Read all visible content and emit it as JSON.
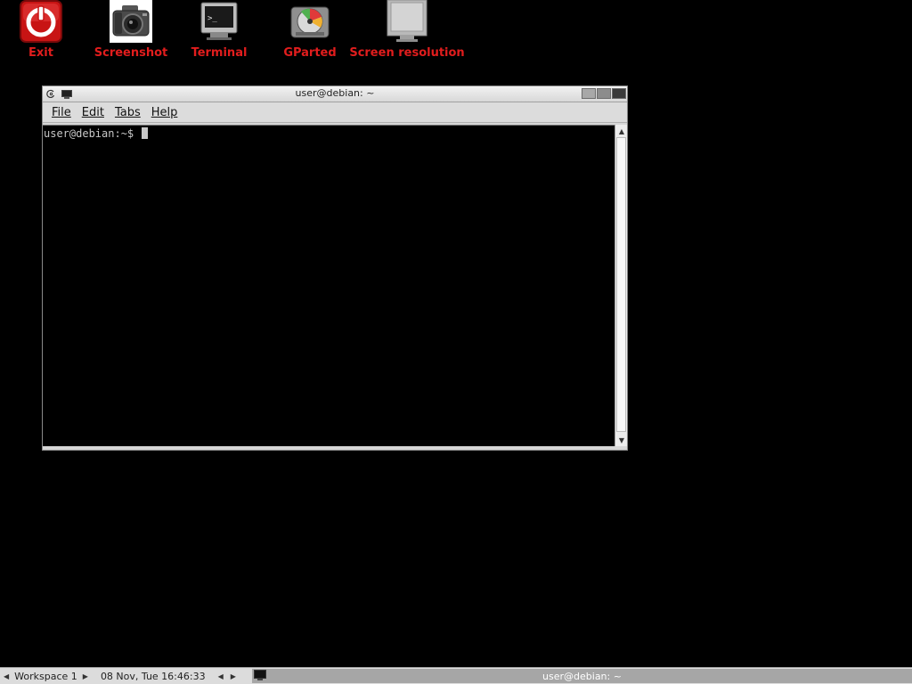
{
  "desktop_icons": [
    {
      "label": "Exit",
      "icon": "power-icon"
    },
    {
      "label": "Screenshot",
      "icon": "camera-icon"
    },
    {
      "label": "Terminal",
      "icon": "terminal-icon"
    },
    {
      "label": "GParted",
      "icon": "disk-icon"
    },
    {
      "label": "Screen resolution",
      "icon": "monitor-icon"
    }
  ],
  "window": {
    "title": "user@debian: ~",
    "menu": [
      "File",
      "Edit",
      "Tabs",
      "Help"
    ],
    "prompt": "user@debian:~$ "
  },
  "taskbar": {
    "workspace": "Workspace 1",
    "datetime": "08 Nov, Tue 16:46:33",
    "task_title": "user@debian: ~"
  },
  "colors": {
    "desktop_background": "#000000",
    "icon_label": "#e11d1d",
    "terminal_text": "#c8c8c8"
  }
}
